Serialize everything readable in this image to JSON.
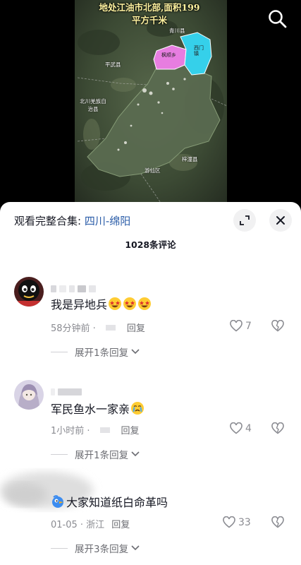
{
  "video": {
    "title_line1": "地处江油市北部,面积199",
    "title_line2": "平方千米",
    "labels": {
      "qingchuan": "青川县",
      "fengshun": "枫顺乡",
      "xiyan": "西门镇",
      "pingwu": "平武县",
      "beichuan": "北川羌族自治县",
      "youxian": "游仙区",
      "zitong": "梓潼县"
    },
    "highlight_colors": {
      "fengshun": "#e77de0",
      "xiyan": "#35d0ea"
    }
  },
  "topbar": {
    "search_icon": "search-icon"
  },
  "sheet": {
    "collection_prefix": "观看完整合集: ",
    "collection_link": "四川-绵阳",
    "comment_count": "1028条评论"
  },
  "comments": [
    {
      "text": "我是异地兵",
      "emoji": "star-struck-emoji x3",
      "time": "58分钟前 ·",
      "reply": "回复",
      "likes": "7",
      "expand": "展开1条回复"
    },
    {
      "text": "军民鱼水一家亲",
      "emoji": "crying-emoji",
      "time": "1小时前 ·",
      "reply": "回复",
      "likes": "4",
      "expand": "展开1条回复"
    },
    {
      "text": "大家知道纸白命革吗",
      "emoji": "blue-bird-emoji",
      "time": "01-05 · 浙江",
      "reply": "回复",
      "likes": "33",
      "expand": "展开3条回复"
    }
  ],
  "colors": {
    "link": "#2a5ca8",
    "text": "#161823",
    "muted": "#8a8b91"
  }
}
